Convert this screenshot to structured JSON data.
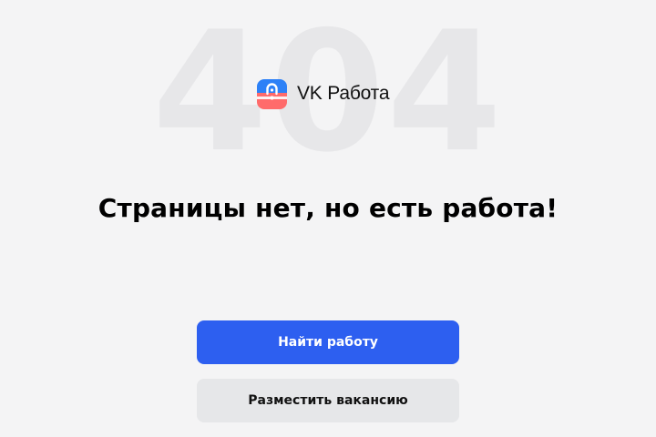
{
  "error": {
    "code": "404"
  },
  "logo": {
    "icon": "briefcase-lock-icon",
    "text": "VK Работа",
    "colors": {
      "top": "#2d81f7",
      "bottom": "#ff6b6b"
    }
  },
  "main": {
    "headline": "Страницы нет, но есть работа!"
  },
  "actions": {
    "find_job": "Найти работу",
    "post_vacancy": "Разместить вакансию"
  },
  "colors": {
    "background": "#f4f4f5",
    "primary": "#2d5ff0",
    "secondary": "#e6e7e9",
    "watermark": "#e7e7e9"
  }
}
